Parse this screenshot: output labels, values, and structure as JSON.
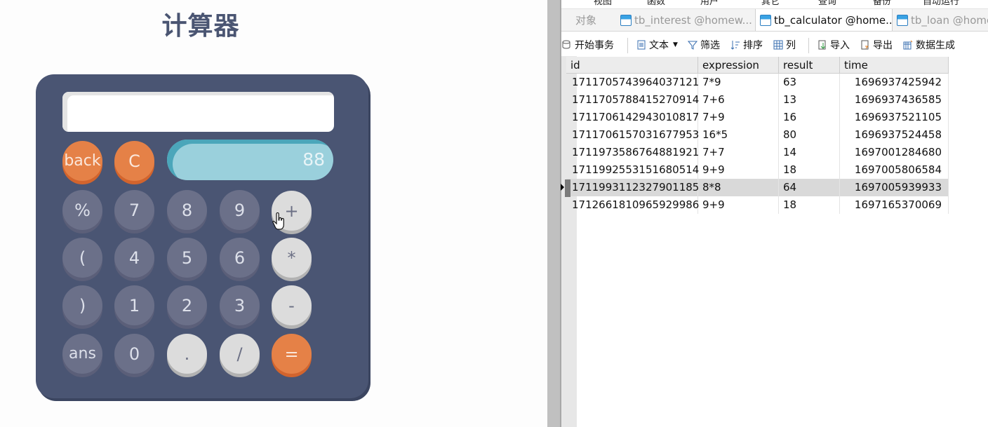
{
  "calculator": {
    "title": "计算器",
    "display_value": "",
    "result_value": "88",
    "buttons": {
      "back": "back",
      "clear": "C",
      "percent": "%",
      "seven": "7",
      "eight": "8",
      "nine": "9",
      "plus": "+",
      "lparen": "(",
      "four": "4",
      "five": "5",
      "six": "6",
      "multiply": "*",
      "rparen": ")",
      "one": "1",
      "two": "2",
      "three": "3",
      "minus": "-",
      "ans": "ans",
      "zero": "0",
      "dot": ".",
      "divide": "/",
      "equals": "="
    },
    "colors": {
      "body": "#4a5573",
      "dark_button": "#6b7089",
      "orange_button": "#e58147",
      "light_button": "#dcdcdc",
      "result_bar": "#9ad0dc"
    }
  },
  "navicat": {
    "menu_fragments": [
      "视图",
      "函数",
      "用户",
      "其它",
      "查询",
      "备份",
      "自动运行"
    ],
    "tabs": [
      {
        "label": "对象"
      },
      {
        "label": "tb_interest @homew..."
      },
      {
        "label": "tb_calculator @home..."
      },
      {
        "label": "tb_loan @home"
      }
    ],
    "toolbar": {
      "begin_transaction": "开始事务",
      "text": "文本",
      "filter": "筛选",
      "sort": "排序",
      "columns": "列",
      "import": "导入",
      "export": "导出",
      "data_generation": "数据生成"
    },
    "table": {
      "columns": [
        "id",
        "expression",
        "result",
        "time"
      ],
      "rows": [
        [
          "1711705743964037121",
          "7*9",
          "63",
          "1696937425942"
        ],
        [
          "1711705788415270914",
          "7+6",
          "13",
          "1696937436585"
        ],
        [
          "1711706142943010817",
          "7+9",
          "16",
          "1696937521105"
        ],
        [
          "1711706157031677953",
          "16*5",
          "80",
          "1696937524458"
        ],
        [
          "1711973586764881921",
          "7+7",
          "14",
          "1697001284680"
        ],
        [
          "1711992553151680514",
          "9+9",
          "18",
          "1697005806584"
        ],
        [
          "1711993112327901185",
          "8*8",
          "64",
          "1697005939933"
        ],
        [
          "1712661810965929986",
          "9+9",
          "18",
          "1697165370069"
        ]
      ],
      "selected_row_index": 6
    }
  }
}
